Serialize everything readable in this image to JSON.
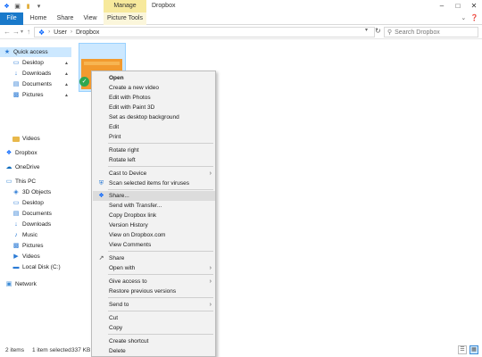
{
  "window": {
    "title": "Dropbox",
    "contextual_tab_header": "Manage",
    "controls": [
      "–",
      "□",
      "✕"
    ]
  },
  "ribbon": {
    "tabs": [
      "File",
      "Home",
      "Share",
      "View",
      "Picture Tools"
    ]
  },
  "address": {
    "path": [
      "User",
      "Dropbox"
    ],
    "search_placeholder": "Search Dropbox"
  },
  "nav": {
    "items": [
      {
        "label": "Quick access",
        "icon": "star-icon"
      },
      {
        "label": "Desktop",
        "icon": "desktop-icon",
        "pinned": true
      },
      {
        "label": "Downloads",
        "icon": "download-icon",
        "pinned": true
      },
      {
        "label": "Documents",
        "icon": "documents-icon",
        "pinned": true
      },
      {
        "label": "Pictures",
        "icon": "pictures-icon",
        "pinned": true
      },
      {
        "label": "Videos",
        "icon": "folder-icon"
      },
      {
        "label": "Dropbox",
        "icon": "dropbox-icon"
      },
      {
        "label": "OneDrive",
        "icon": "cloud-icon"
      },
      {
        "label": "This PC",
        "icon": "computer-icon"
      },
      {
        "label": "3D Objects",
        "icon": "cube-icon"
      },
      {
        "label": "Desktop",
        "icon": "desktop-icon"
      },
      {
        "label": "Documents",
        "icon": "documents-icon"
      },
      {
        "label": "Downloads",
        "icon": "download-icon"
      },
      {
        "label": "Music",
        "icon": "music-icon"
      },
      {
        "label": "Pictures",
        "icon": "pictures-icon"
      },
      {
        "label": "Videos",
        "icon": "video-icon"
      },
      {
        "label": "Local Disk (C:)",
        "icon": "disk-icon"
      },
      {
        "label": "Network",
        "icon": "network-icon"
      }
    ]
  },
  "status": {
    "items_count": "2 items",
    "selection": "1 item selected",
    "size": "337 KB"
  },
  "context_menu": {
    "items": [
      {
        "label": "Open",
        "bold": true
      },
      {
        "label": "Create a new video"
      },
      {
        "label": "Edit with Photos"
      },
      {
        "label": "Edit with Paint 3D"
      },
      {
        "label": "Set as desktop background"
      },
      {
        "label": "Edit"
      },
      {
        "label": "Print"
      },
      {
        "label": "Rotate right"
      },
      {
        "label": "Rotate left"
      },
      {
        "label": "Cast to Device",
        "submenu": true
      },
      {
        "label": "Scan selected items for viruses",
        "icon": "defender-icon"
      },
      {
        "label": "Share...",
        "icon": "dropbox-icon",
        "highlighted": true
      },
      {
        "label": "Send with Transfer..."
      },
      {
        "label": "Copy Dropbox link"
      },
      {
        "label": "Version History"
      },
      {
        "label": "View on Dropbox.com"
      },
      {
        "label": "View Comments"
      },
      {
        "label": "Share",
        "icon": "share-icon"
      },
      {
        "label": "Open with",
        "submenu": true
      },
      {
        "label": "Give access to",
        "submenu": true
      },
      {
        "label": "Restore previous versions"
      },
      {
        "label": "Send to",
        "submenu": true
      },
      {
        "label": "Cut"
      },
      {
        "label": "Copy"
      },
      {
        "label": "Create shortcut"
      },
      {
        "label": "Delete"
      }
    ]
  },
  "colors": {
    "accent": "#1979ca",
    "selection": "#cce8ff",
    "contextual_tab": "#f7e99c",
    "dropbox_blue": "#0061fe"
  }
}
